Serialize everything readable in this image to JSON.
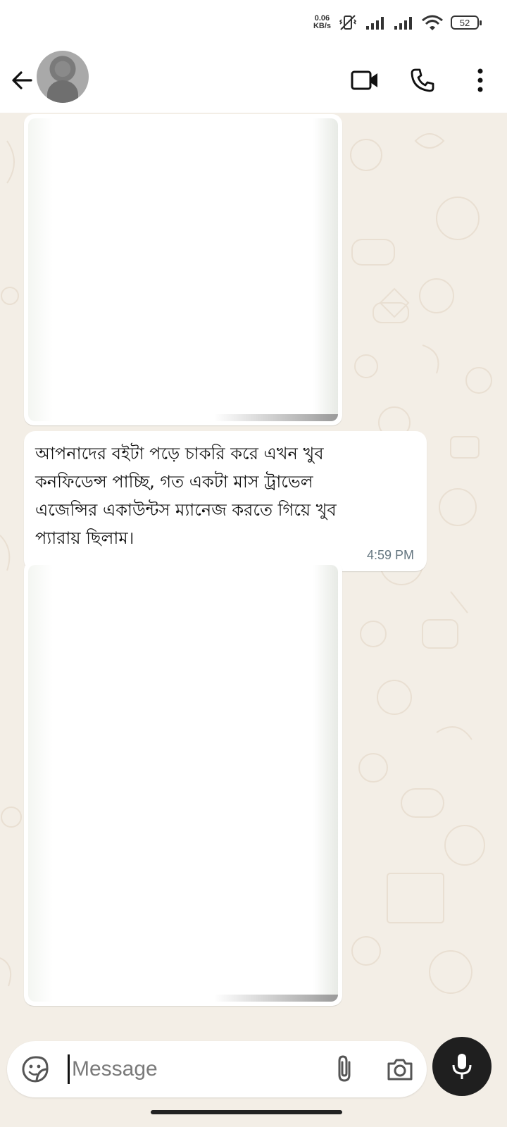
{
  "status_bar": {
    "net_speed": "0.06",
    "net_unit": "KB/s",
    "battery": "52",
    "icons": [
      "vibrate-off-icon",
      "signal-icon",
      "signal-icon",
      "wifi-icon",
      "battery-icon"
    ]
  },
  "header": {
    "back_icon": "arrow-left-icon",
    "avatar": "contact-avatar",
    "actions": [
      "video-call-icon",
      "voice-call-icon",
      "more-vertical-icon"
    ]
  },
  "messages": [
    {
      "type": "image"
    },
    {
      "type": "text",
      "text": "আপনাদের বইটা পড়ে চাকরি করে এখন খুব\nকনফিডেন্স পাচ্ছি, গত একটা মাস ট্রাভেল\nএজেন্সির একাউন্টস ম্যানেজ করতে গিয়ে খুব\nপ্যারায় ছিলাম।",
      "time": "4:59 PM"
    },
    {
      "type": "image"
    }
  ],
  "composer": {
    "placeholder": "Message",
    "emoji_icon": "sticker-icon",
    "attach_icon": "paperclip-icon",
    "camera_icon": "camera-icon",
    "mic_icon": "microphone-icon"
  },
  "colors": {
    "wallpaper": "#f3eee6",
    "bubble": "#ffffff",
    "time": "#667781",
    "mic_button": "#1f1f1f"
  }
}
